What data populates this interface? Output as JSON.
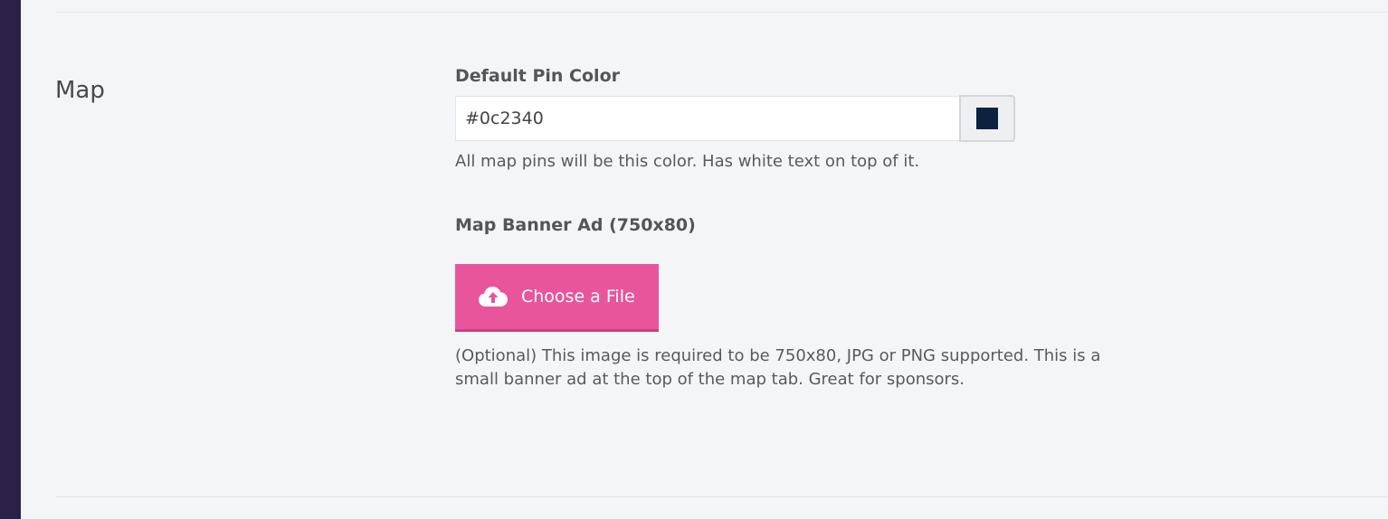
{
  "section": {
    "title": "Map"
  },
  "pin_color": {
    "label": "Default Pin Color",
    "value": "#0c2340",
    "swatch_color": "#0c2340",
    "help": "All map pins will be this color. Has white text on top of it."
  },
  "banner_ad": {
    "label": "Map Banner Ad (750x80)",
    "button_label": "Choose a File",
    "button_icon": "cloud-upload-icon",
    "button_color": "#e8559b",
    "help": "(Optional) This image is required to be 750x80, JPG or PNG supported. This is a small banner ad at the top of the map tab. Great for sponsors."
  }
}
